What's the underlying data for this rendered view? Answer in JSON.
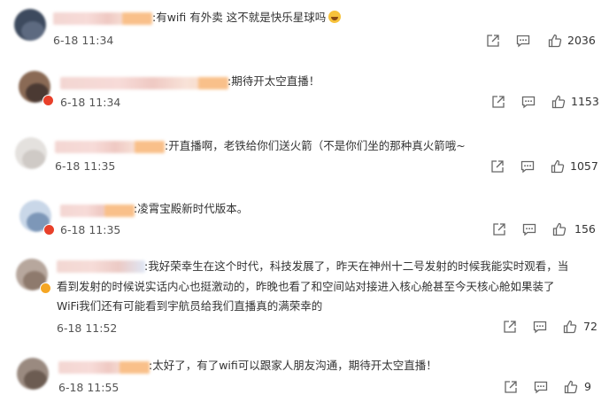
{
  "comments": [
    {
      "text": ":有wifi 有外卖 这不就是快乐星球吗",
      "time": "6-18 11:34",
      "likes": "2036",
      "emoji": "laughing-tears-emoji"
    },
    {
      "text": ":期待开太空直播！",
      "time": "6-18 11:34",
      "likes": "1153"
    },
    {
      "text": ":开直播啊，老铁给你们送火箭（不是你们坐的那种真火箭哦~",
      "time": "6-18 11:35",
      "likes": "1057"
    },
    {
      "text": ":凌霄宝殿新时代版本。",
      "time": "6-18 11:35",
      "likes": "156"
    },
    {
      "lines": [
        ":我好荣幸生在这个时代，科技发展了，昨天在神州十二号发射的时候我能实时观看，当",
        "看到发射的时候说实话内心也挺激动的，昨晚也看了和空间站对接进入核心舱甚至今天核心舱如果装了",
        "WiFi我们还有可能看到宇航员给我们直播真的满荣幸的"
      ],
      "time": "6-18 11:52",
      "likes": "72"
    },
    {
      "text": ":太好了，有了wifi可以跟家人朋友沟通，期待开太空直播！",
      "time": "6-18 11:55",
      "likes": "9"
    }
  ],
  "icons": {
    "share": "share-icon",
    "comment": "comment-icon",
    "like": "thumbs-up-icon"
  },
  "colors": {
    "verified_badge": "#f5a623",
    "verified_badge_red": "#e8402a",
    "text": "#333333"
  }
}
